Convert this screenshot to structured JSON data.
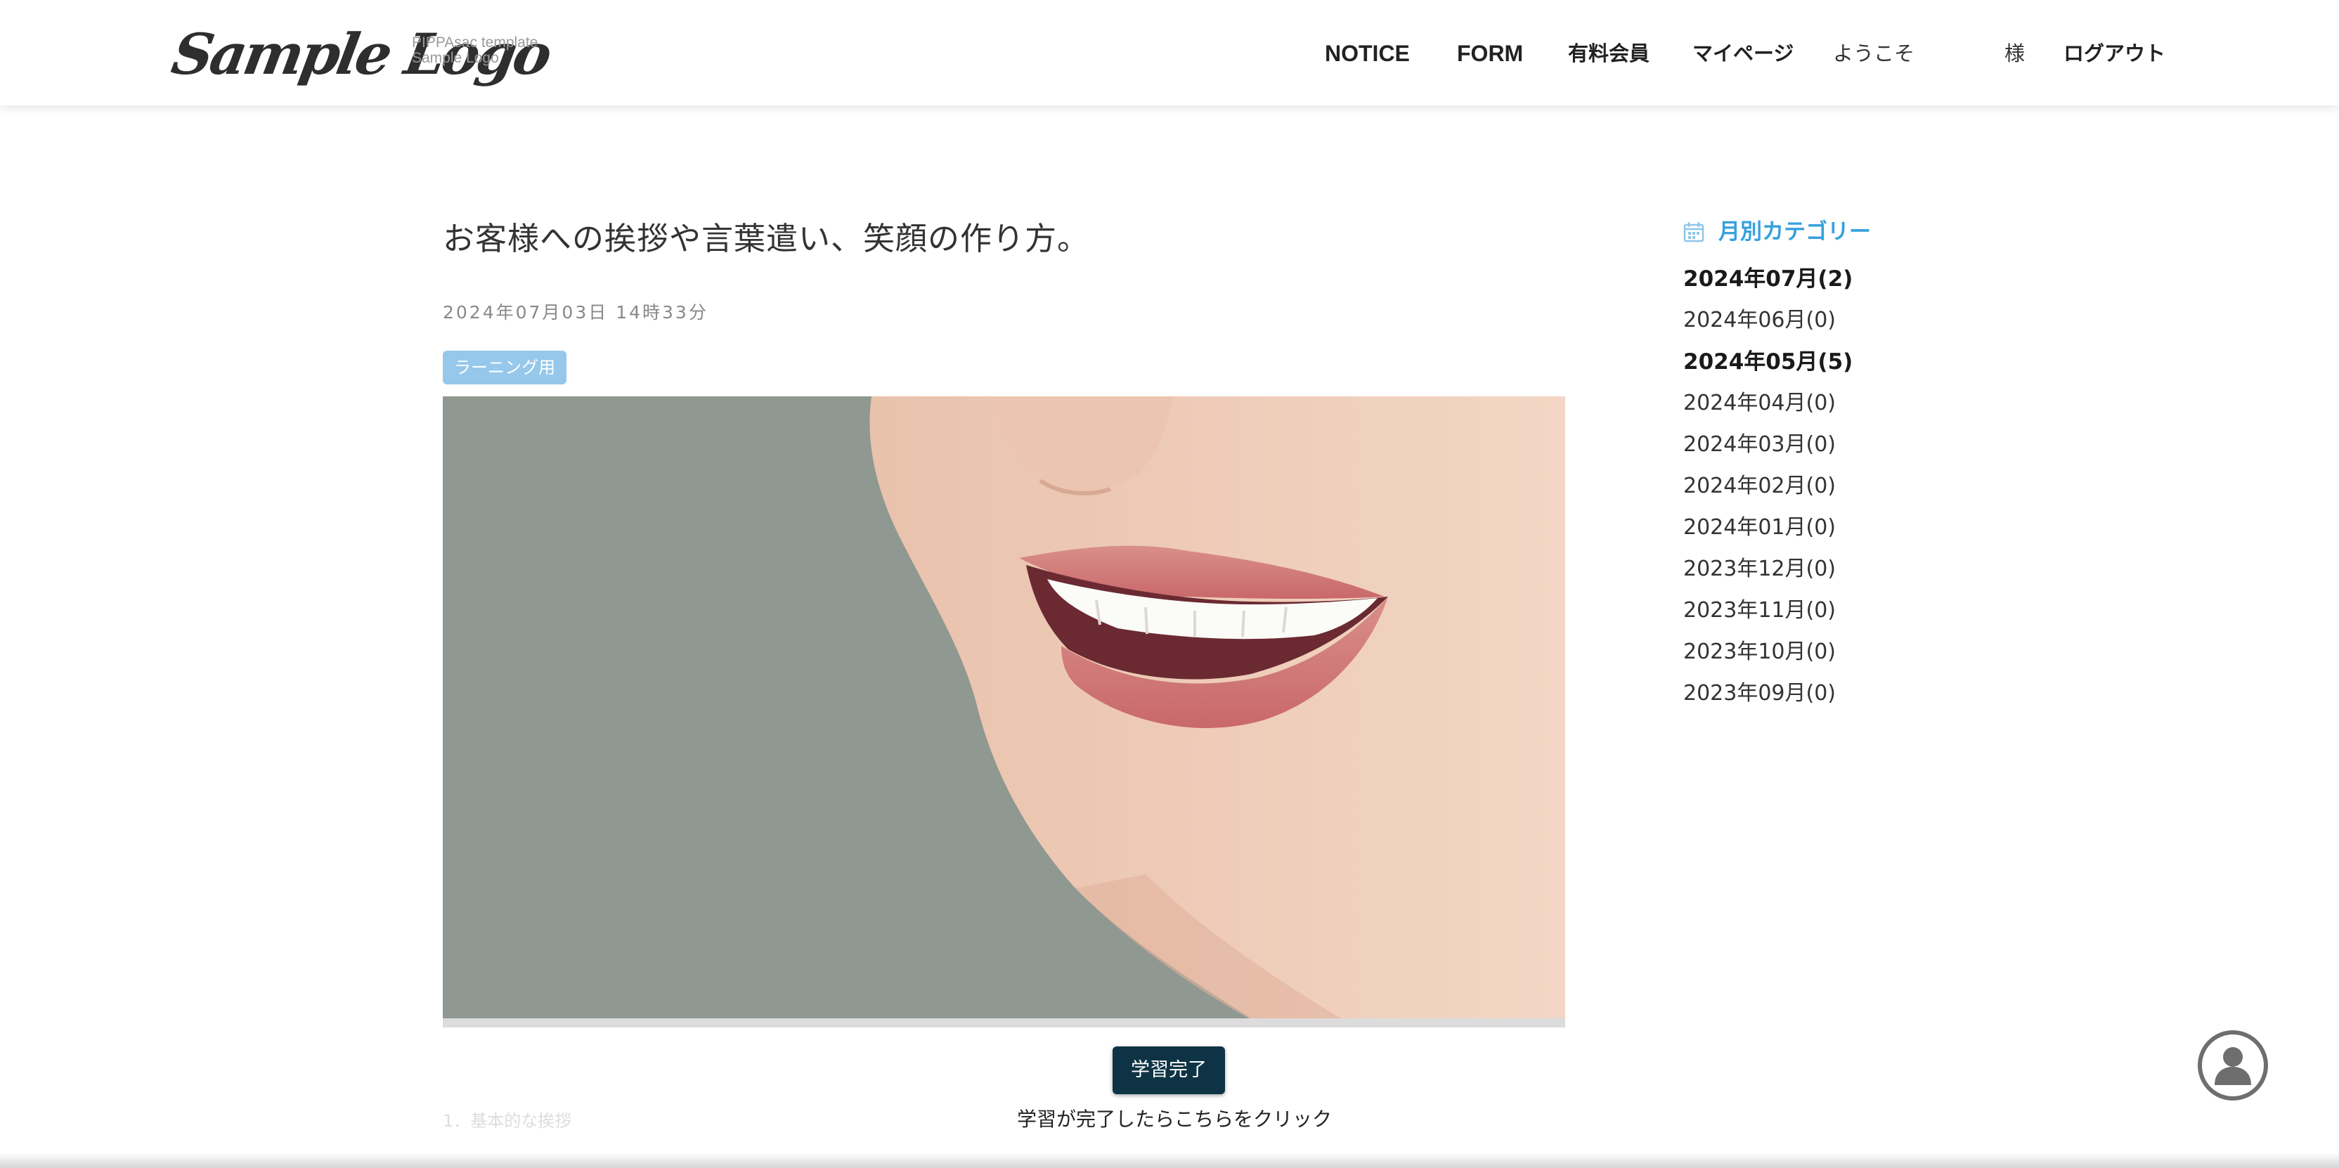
{
  "header": {
    "logo_text": "Sample Logo",
    "logo_sub_1": "PIPPAsac template",
    "logo_sub_2": "Sample Logo",
    "nav": {
      "notice": "NOTICE",
      "form": "FORM",
      "paid_member": "有料会員",
      "my_page": "マイページ",
      "welcome": "ようこそ",
      "sama": "様",
      "logout": "ログアウト"
    }
  },
  "article": {
    "title": "お客様への挨拶や言葉遣い、笑顔の作り方。",
    "date": "2024年07月03日 14時33分",
    "tag": "ラーニング用",
    "image_icon": "smiling-mouth-photo",
    "section_heading": "1．基本的な挨拶",
    "complete_button": "学習完了",
    "complete_hint": "学習が完了したらこちらをクリック"
  },
  "sidebar": {
    "heading_icon": "calendar-icon",
    "heading": "月別カテゴリー",
    "months": [
      {
        "label": "2024年07月(2)",
        "strong": true
      },
      {
        "label": "2024年06月(0)",
        "strong": false
      },
      {
        "label": "2024年05月(5)",
        "strong": true
      },
      {
        "label": "2024年04月(0)",
        "strong": false
      },
      {
        "label": "2024年03月(0)",
        "strong": false
      },
      {
        "label": "2024年02月(0)",
        "strong": false
      },
      {
        "label": "2024年01月(0)",
        "strong": false
      },
      {
        "label": "2023年12月(0)",
        "strong": false
      },
      {
        "label": "2023年11月(0)",
        "strong": false
      },
      {
        "label": "2023年10月(0)",
        "strong": false
      },
      {
        "label": "2023年09月(0)",
        "strong": false
      }
    ]
  },
  "floating": {
    "icon": "user-avatar-icon"
  },
  "colors": {
    "accent": "#35a1dc",
    "tag_bg": "#95c8ea",
    "button_bg": "#0e3345",
    "photo_bg": "#8f9891"
  }
}
